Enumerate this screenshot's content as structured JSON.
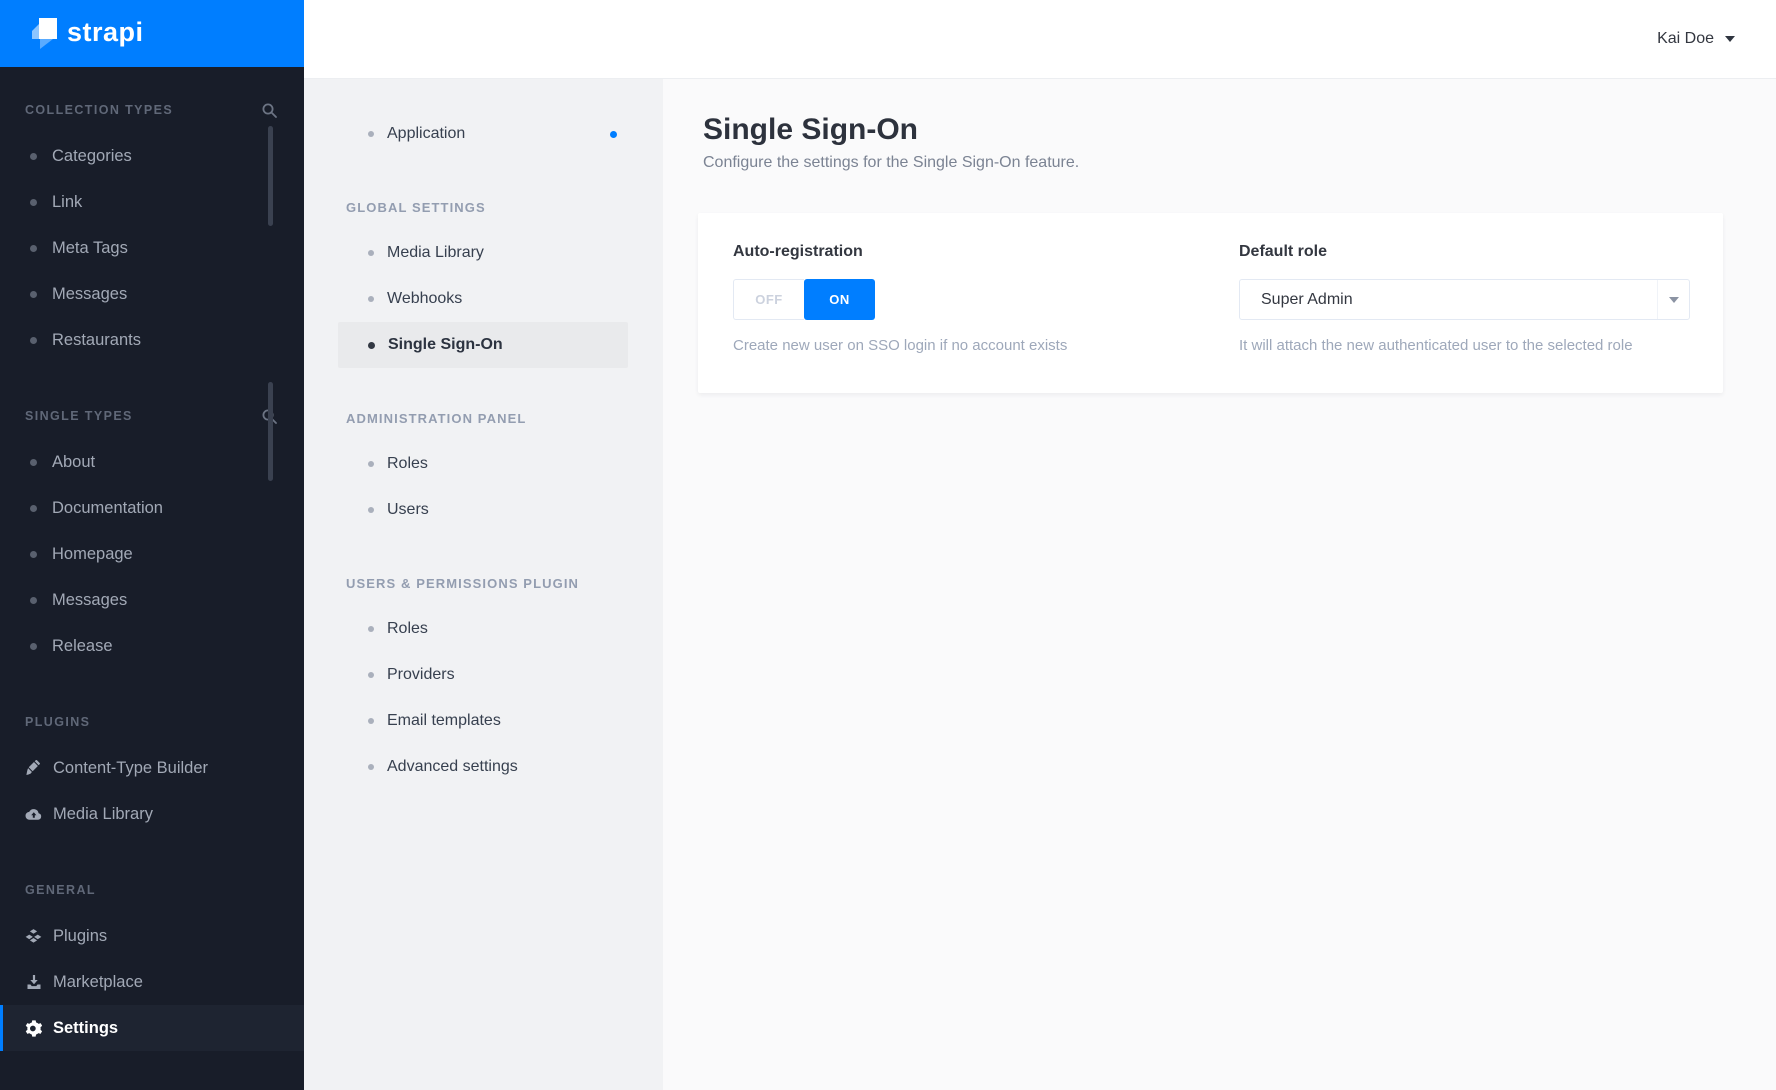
{
  "app": {
    "logo_text": "strapi",
    "accent_color": "#007eff"
  },
  "topbar": {
    "user_name": "Kai Doe"
  },
  "sidebar": {
    "sections": [
      {
        "label": "COLLECTION TYPES",
        "has_search": true,
        "items": [
          {
            "label": "Categories"
          },
          {
            "label": "Link"
          },
          {
            "label": "Meta Tags"
          },
          {
            "label": "Messages"
          },
          {
            "label": "Restaurants"
          }
        ]
      },
      {
        "label": "SINGLE TYPES",
        "has_search": true,
        "items": [
          {
            "label": "About"
          },
          {
            "label": "Documentation"
          },
          {
            "label": "Homepage"
          },
          {
            "label": "Messages"
          },
          {
            "label": "Release"
          }
        ]
      },
      {
        "label": "PLUGINS",
        "items": [
          {
            "label": "Content-Type Builder",
            "icon": "paintbrush-icon"
          },
          {
            "label": "Media Library",
            "icon": "cloud-upload-icon"
          }
        ]
      },
      {
        "label": "GENERAL",
        "items": [
          {
            "label": "Plugins",
            "icon": "cubes-icon"
          },
          {
            "label": "Marketplace",
            "icon": "download-icon"
          },
          {
            "label": "Settings",
            "icon": "gear-icon",
            "active": true
          }
        ]
      }
    ]
  },
  "subnav": {
    "top_item": {
      "label": "Application",
      "has_notification_dot": true
    },
    "sections": [
      {
        "label": "GLOBAL SETTINGS",
        "items": [
          {
            "label": "Media Library"
          },
          {
            "label": "Webhooks"
          },
          {
            "label": "Single Sign-On",
            "active": true
          }
        ]
      },
      {
        "label": "ADMINISTRATION PANEL",
        "items": [
          {
            "label": "Roles"
          },
          {
            "label": "Users"
          }
        ]
      },
      {
        "label": "USERS & PERMISSIONS PLUGIN",
        "items": [
          {
            "label": "Roles"
          },
          {
            "label": "Providers"
          },
          {
            "label": "Email templates"
          },
          {
            "label": "Advanced settings"
          }
        ]
      }
    ]
  },
  "main": {
    "title": "Single Sign-On",
    "subtitle": "Configure the settings for the Single Sign-On feature.",
    "card": {
      "auto_registration": {
        "label": "Auto-registration",
        "off_label": "OFF",
        "on_label": "ON",
        "value": "ON",
        "help": "Create new user on SSO login if no account exists"
      },
      "default_role": {
        "label": "Default role",
        "value": "Super Admin",
        "help": "It will attach the new authenticated user to the selected role"
      }
    }
  }
}
